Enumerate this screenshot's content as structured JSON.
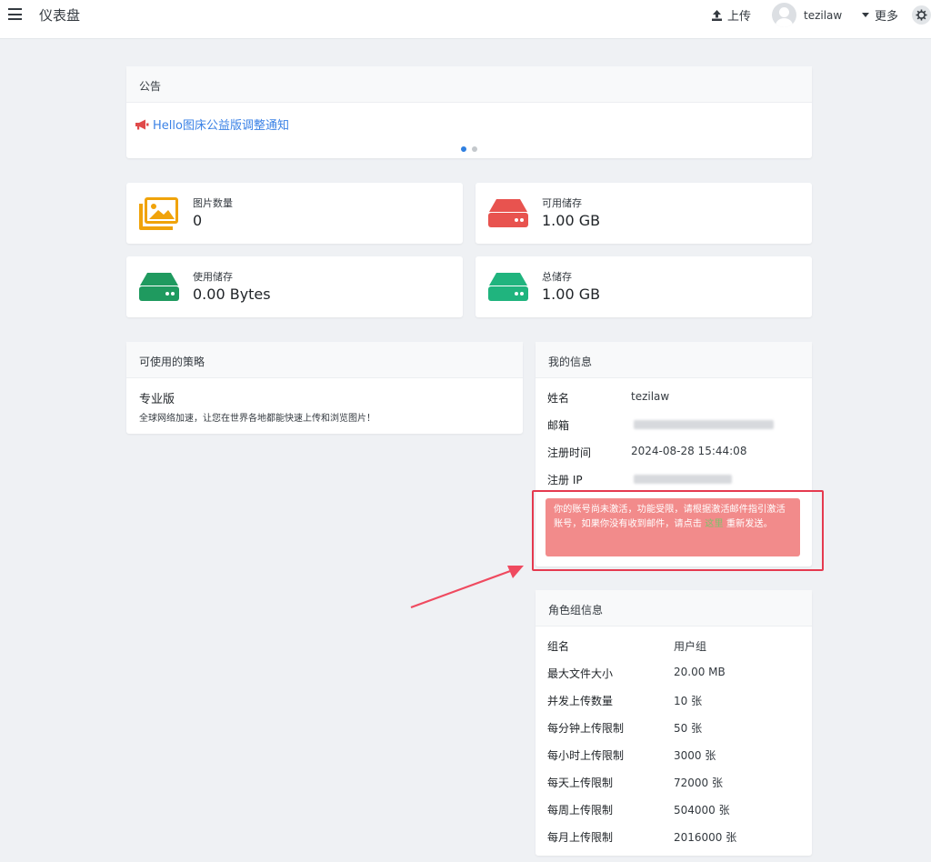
{
  "nav": {
    "title": "仪表盘",
    "upload_label": "上传",
    "username": "tezilaw",
    "more_label": "更多"
  },
  "announcement": {
    "header": "公告",
    "link_text": "Hello图床公益版调整通知",
    "slides": 2,
    "active_slide": 1
  },
  "stats": {
    "images": {
      "label": "图片数量",
      "value": "0",
      "color": "#f0a30a"
    },
    "available": {
      "label": "可用储存",
      "value": "1.00 GB",
      "color": "#e8534f"
    },
    "used": {
      "label": "使用储存",
      "value": "0.00 Bytes",
      "color": "#1f9a5f"
    },
    "total": {
      "label": "总储存",
      "value": "1.00 GB",
      "color": "#20b47e"
    }
  },
  "policy": {
    "header": "可使用的策略",
    "name": "专业版",
    "description": "全球网络加速，让您在世界各地都能快速上传和浏览图片！"
  },
  "my_info": {
    "header": "我的信息",
    "rows": [
      {
        "label": "姓名",
        "value": "tezilaw"
      },
      {
        "label": "邮箱",
        "value": ""
      },
      {
        "label": "注册时间",
        "value": "2024-08-28 15:44:08"
      },
      {
        "label": "注册 IP",
        "value": ""
      }
    ],
    "alert": {
      "text_before": "你的账号尚未激活，功能受限，请根据激活邮件指引激活账号，如果你没有收到邮件，请点击 ",
      "link": "这里",
      "text_after": " 重新发送。",
      "color": "#f28b8b"
    }
  },
  "role": {
    "header": "角色组信息",
    "rows": [
      {
        "label": "组名",
        "value": "用户组"
      },
      {
        "label": "最大文件大小",
        "value": "20.00 MB"
      },
      {
        "label": "并发上传数量",
        "value": "10 张"
      },
      {
        "label": "每分钟上传限制",
        "value": "50 张"
      },
      {
        "label": "每小时上传限制",
        "value": "3000 张"
      },
      {
        "label": "每天上传限制",
        "value": "72000 张"
      },
      {
        "label": "每周上传限制",
        "value": "504000 张"
      },
      {
        "label": "每月上传限制",
        "value": "2016000 张"
      }
    ]
  },
  "annotation": {
    "highlight_color": "#e53a4f"
  }
}
